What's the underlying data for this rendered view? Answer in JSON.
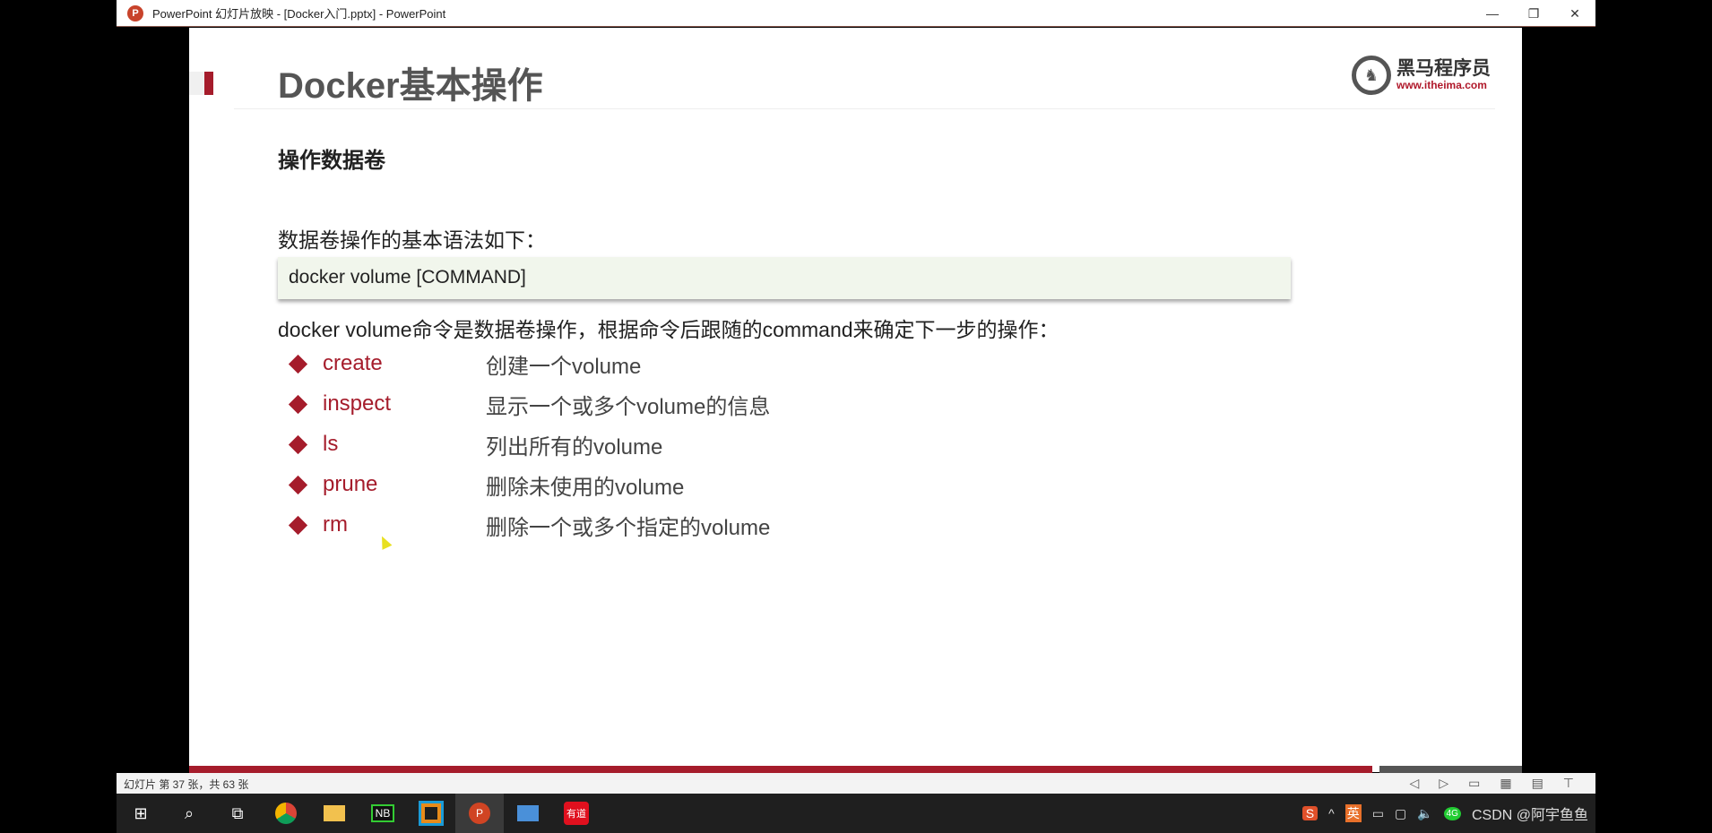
{
  "window": {
    "title": "PowerPoint 幻灯片放映 - [Docker入门.pptx] - PowerPoint",
    "app_icon": "P",
    "minimize": "—",
    "restore": "❐",
    "close": "✕"
  },
  "slide": {
    "title": "Docker基本操作",
    "logo": {
      "name": "黑马程序员",
      "url": "www.itheima.com"
    },
    "subtitle": "操作数据卷",
    "intro": "数据卷操作的基本语法如下：",
    "code": "docker volume [COMMAND]",
    "description": "docker volume命令是数据卷操作，根据命令后跟随的command来确定下一步的操作：",
    "commands": [
      {
        "cmd": "create",
        "desc": "创建一个volume"
      },
      {
        "cmd": "inspect",
        "desc": "显示一个或多个volume的信息"
      },
      {
        "cmd": "ls",
        "desc": "列出所有的volume"
      },
      {
        "cmd": "prune",
        "desc": "删除未使用的volume"
      },
      {
        "cmd": "rm",
        "desc": "删除一个或多个指定的volume"
      }
    ],
    "accent": "#a51c2b"
  },
  "status": {
    "slide_info": "幻灯片 第 37 张，共 63 张"
  },
  "taskbar": {
    "apps": [
      "start",
      "search",
      "task-view",
      "chrome",
      "file-explorer",
      "notepad-nb",
      "virtualbox",
      "powerpoint",
      "remote-desktop",
      "youdao"
    ],
    "youdao_label": "有道",
    "tray_ime": "英",
    "watermark": "CSDN @阿宇鱼鱼"
  }
}
